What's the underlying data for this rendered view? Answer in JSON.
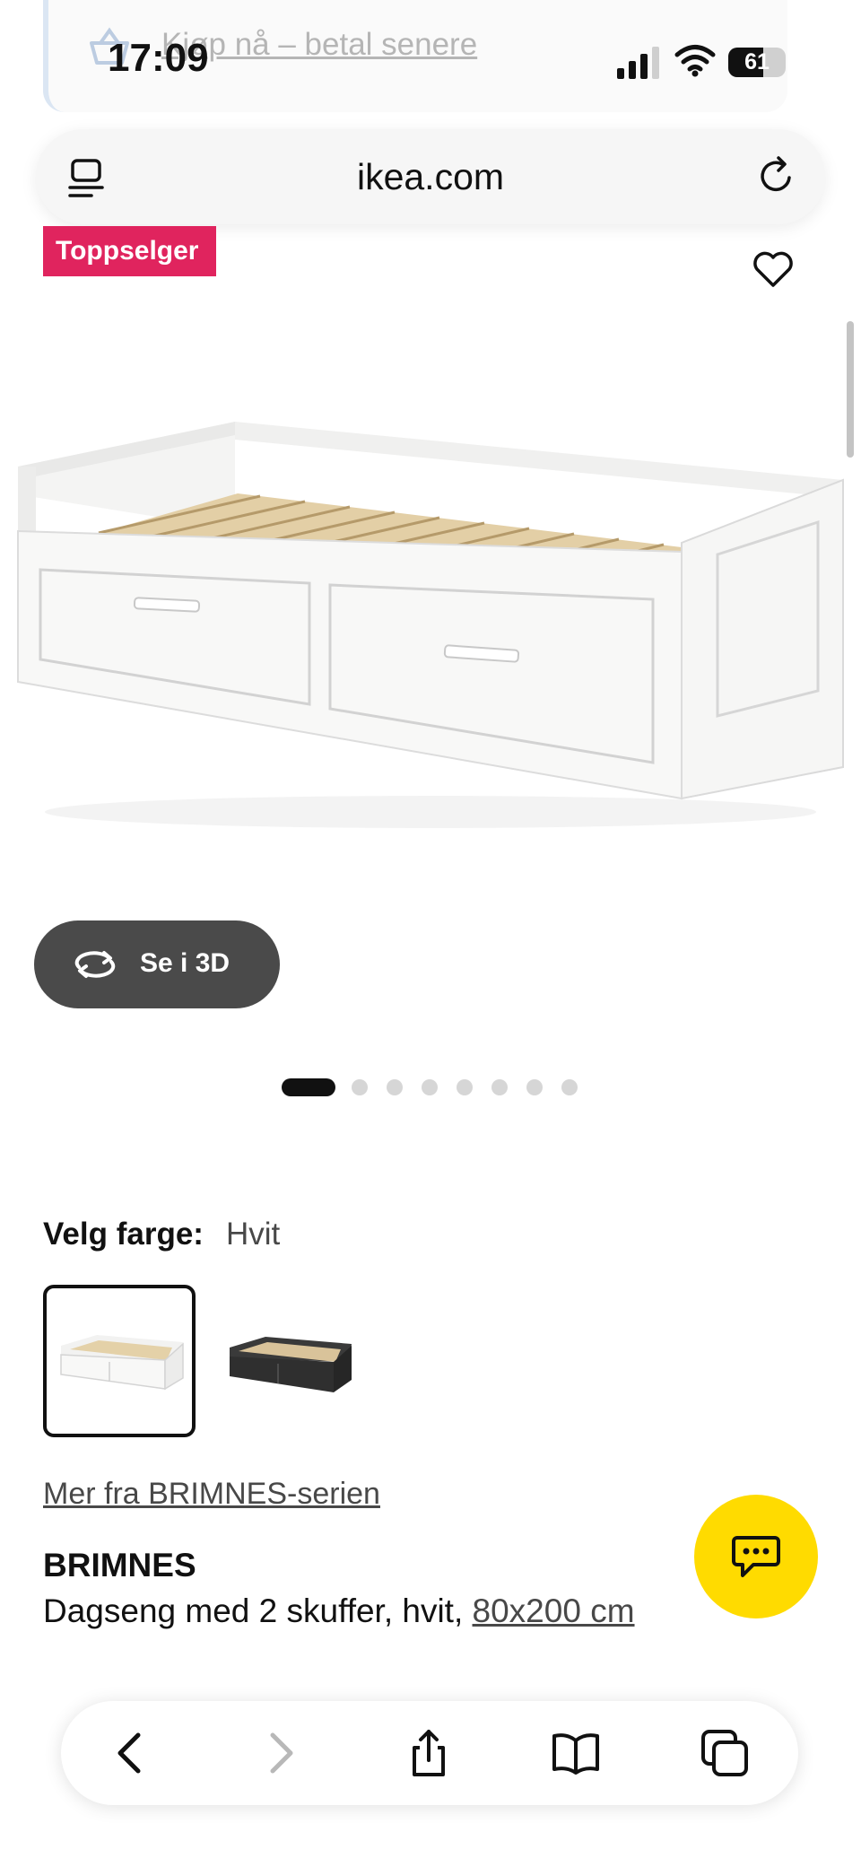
{
  "banner": {
    "link_text": "Kjøp nå – betal senere"
  },
  "status_bar": {
    "time": "17:09",
    "battery_level": 61,
    "battery_text": "61"
  },
  "browser": {
    "url": "ikea.com"
  },
  "product_image": {
    "badge": "Toppselger",
    "view_3d_label": "Se i 3D",
    "carousel": {
      "total": 8,
      "active_index": 0
    }
  },
  "color_chooser": {
    "label": "Velg farge:",
    "value": "Hvit",
    "options": [
      {
        "name": "white",
        "selected": true
      },
      {
        "name": "black-brown",
        "selected": false
      }
    ]
  },
  "series_link": "Mer fra BRIMNES-serien",
  "product": {
    "name": "BRIMNES",
    "description": "Dagseng med 2 skuffer, hvit,",
    "size": "80x200 cm"
  },
  "toolbar": {
    "items": [
      "back",
      "forward",
      "share",
      "bookmarks",
      "tabs"
    ]
  },
  "colors": {
    "badge": "#e0245e",
    "chat": "#ffdb00",
    "button_dark": "#4a4a4a"
  }
}
